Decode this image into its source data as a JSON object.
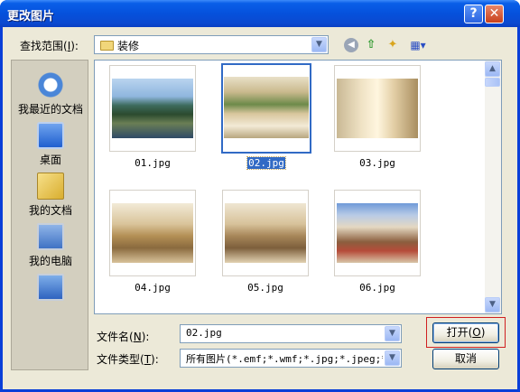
{
  "window": {
    "title": "更改图片",
    "help_label": "?",
    "close_label": "✕"
  },
  "lookin": {
    "label": "查找范围",
    "hotkey": "I",
    "value": "装修"
  },
  "toolbar": {
    "icons": [
      "back-icon",
      "up-folder-icon",
      "new-folder-icon",
      "views-menu-icon"
    ]
  },
  "places": [
    {
      "label": "我最近的文档",
      "icon": "recent-documents-icon"
    },
    {
      "label": "桌面",
      "icon": "desktop-icon"
    },
    {
      "label": "我的文档",
      "icon": "my-documents-icon"
    },
    {
      "label": "我的电脑",
      "icon": "my-computer-icon"
    },
    {
      "label": "",
      "icon": "network-places-icon"
    }
  ],
  "files": [
    {
      "name": "01.jpg",
      "selected": false
    },
    {
      "name": "02.jpg",
      "selected": true
    },
    {
      "name": "03.jpg",
      "selected": false
    },
    {
      "name": "04.jpg",
      "selected": false
    },
    {
      "name": "05.jpg",
      "selected": false
    },
    {
      "name": "06.jpg",
      "selected": false
    }
  ],
  "filename": {
    "label": "文件名",
    "hotkey": "N",
    "value": "02.jpg"
  },
  "filetype": {
    "label": "文件类型",
    "hotkey": "T",
    "value": "所有图片(*.emf;*.wmf;*.jpg;*.jpeg;*.j"
  },
  "buttons": {
    "open_label": "打开",
    "open_hotkey": "O",
    "cancel_label": "取消"
  },
  "colors": {
    "title_bar": "#0551dc",
    "selection": "#316ac5",
    "dialog_bg": "#ece9d8",
    "focus_outline": "#d02020"
  }
}
